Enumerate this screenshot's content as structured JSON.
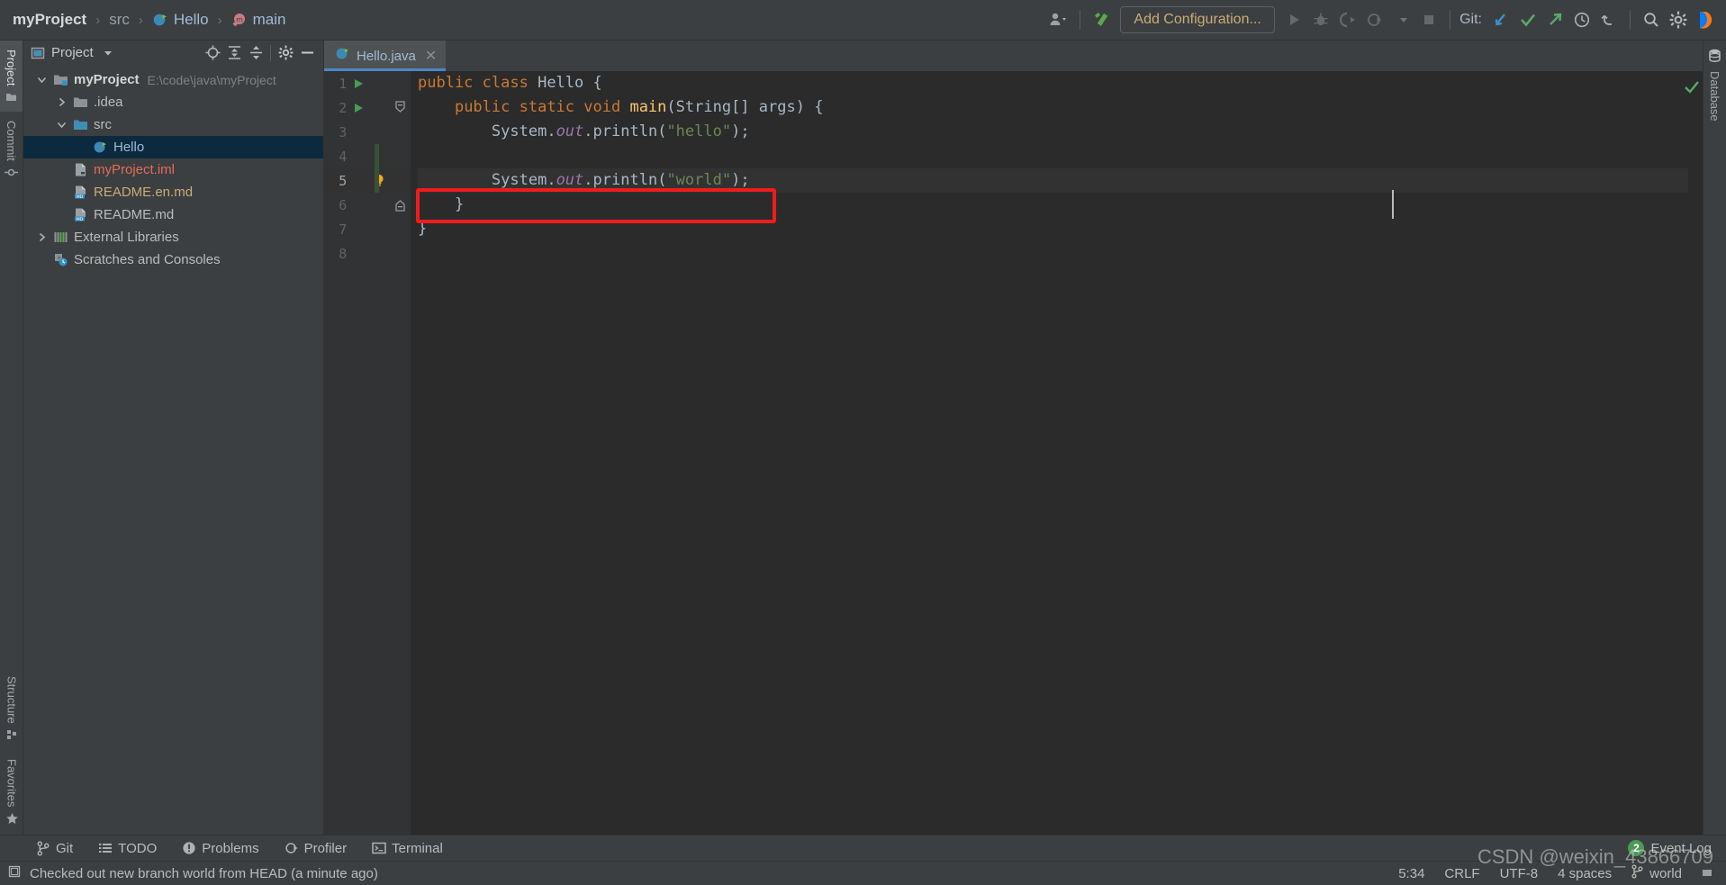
{
  "navbar": {
    "breadcrumbs": [
      {
        "label": "myProject",
        "icon": "",
        "style": "bold"
      },
      {
        "label": "src",
        "icon": "",
        "style": "dim"
      },
      {
        "label": "Hello",
        "icon": "java-class-icon",
        "style": "normal"
      },
      {
        "label": "main",
        "icon": "method-icon",
        "style": "normal"
      }
    ],
    "separator": "›",
    "user_icon": "user-dropdown-icon",
    "build_icon": "build-hammer-icon",
    "add_configuration_label": "Add Configuration...",
    "run_icon": "run-icon",
    "debug_icon": "debug-icon",
    "coverage_icon": "run-coverage-icon",
    "profile_icon": "profile-icon",
    "stop_icon": "stop-icon",
    "git_label": "Git:",
    "git_update_icon": "git-update-project-icon",
    "git_commit_icon": "git-commit-icon",
    "git_push_icon": "git-push-icon",
    "history_icon": "history-icon",
    "undo_icon": "undo-icon",
    "search_icon": "search-everywhere-icon",
    "settings_icon": "settings-gear-icon",
    "ide_icon": "ide-logo-icon"
  },
  "left_rail": {
    "top": [
      {
        "label": "Project",
        "icon": "project-folder-icon",
        "active": true
      },
      {
        "label": "Commit",
        "icon": "commit-icon",
        "active": false
      }
    ],
    "bottom": [
      {
        "label": "Structure",
        "icon": "structure-icon",
        "active": false
      },
      {
        "label": "Favorites",
        "icon": "star-icon",
        "active": false
      }
    ]
  },
  "right_rail": {
    "items": [
      {
        "label": "Database",
        "icon": "database-icon"
      }
    ]
  },
  "project_panel": {
    "title": "Project",
    "title_icon": "project-view-icon",
    "dropdown_icon": "chevron-down-icon",
    "locate_icon": "scroll-from-source-icon",
    "expand_icon": "expand-all-icon",
    "collapse_icon": "collapse-all-icon",
    "settings_icon": "gear-icon",
    "hide_icon": "hide-panel-icon",
    "tree": [
      {
        "label": "myProject",
        "path": "E:\\code\\java\\myProject",
        "icon": "module-folder-icon",
        "twisty": "down",
        "indent": 0,
        "style": "bold",
        "selected": false
      },
      {
        "label": ".idea",
        "path": "",
        "icon": "folder-icon",
        "twisty": "right",
        "indent": 1,
        "style": "normal",
        "selected": false
      },
      {
        "label": "src",
        "path": "",
        "icon": "source-folder-icon",
        "twisty": "down",
        "indent": 1,
        "style": "normal",
        "selected": false
      },
      {
        "label": "Hello",
        "path": "",
        "icon": "java-class-icon",
        "twisty": "none",
        "indent": 2,
        "style": "blue",
        "selected": true
      },
      {
        "label": "myProject.iml",
        "path": "",
        "icon": "iml-file-icon",
        "twisty": "none",
        "indent": 1,
        "style": "red",
        "selected": false
      },
      {
        "label": "README.en.md",
        "path": "",
        "icon": "markdown-file-icon",
        "twisty": "none",
        "indent": 1,
        "style": "orange",
        "selected": false
      },
      {
        "label": "README.md",
        "path": "",
        "icon": "markdown-file-icon",
        "twisty": "none",
        "indent": 1,
        "style": "normal",
        "selected": false
      },
      {
        "label": "External Libraries",
        "path": "",
        "icon": "libraries-icon",
        "twisty": "right",
        "indent": 0,
        "style": "normal",
        "selected": false
      },
      {
        "label": "Scratches and Consoles",
        "path": "",
        "icon": "scratches-icon",
        "twisty": "none",
        "indent": 0,
        "style": "normal",
        "selected": false
      }
    ]
  },
  "editor": {
    "tab": {
      "name": "Hello.java",
      "icon": "java-class-icon",
      "close": "✕"
    },
    "lines": [
      {
        "num": "1",
        "run": true,
        "fold": "none",
        "bulb": false,
        "current": false,
        "changed": false,
        "tokens": [
          {
            "t": "public ",
            "c": "kw"
          },
          {
            "t": "class ",
            "c": "kw"
          },
          {
            "t": "Hello ",
            "c": "cls"
          },
          {
            "t": "{",
            "c": "pl"
          }
        ]
      },
      {
        "num": "2",
        "run": true,
        "fold": "open",
        "bulb": false,
        "current": false,
        "changed": false,
        "tokens": [
          {
            "t": "    ",
            "c": "pl"
          },
          {
            "t": "public ",
            "c": "kw"
          },
          {
            "t": "static ",
            "c": "kw"
          },
          {
            "t": "void ",
            "c": "kw"
          },
          {
            "t": "main",
            "c": "fn"
          },
          {
            "t": "(",
            "c": "pl"
          },
          {
            "t": "String[] ",
            "c": "cls"
          },
          {
            "t": "args",
            "c": "var"
          },
          {
            "t": ") {",
            "c": "pl"
          }
        ]
      },
      {
        "num": "3",
        "run": false,
        "fold": "none",
        "bulb": false,
        "current": false,
        "changed": false,
        "tokens": [
          {
            "t": "        ",
            "c": "pl"
          },
          {
            "t": "System",
            "c": "cls"
          },
          {
            "t": ".",
            "c": "pl"
          },
          {
            "t": "out",
            "c": "fld"
          },
          {
            "t": ".",
            "c": "pl"
          },
          {
            "t": "println",
            "c": "cls"
          },
          {
            "t": "(",
            "c": "pl"
          },
          {
            "t": "\"hello\"",
            "c": "st"
          },
          {
            "t": ");",
            "c": "pl"
          }
        ]
      },
      {
        "num": "4",
        "run": false,
        "fold": "none",
        "bulb": false,
        "current": false,
        "changed": true,
        "tokens": []
      },
      {
        "num": "5",
        "run": false,
        "fold": "none",
        "bulb": true,
        "current": true,
        "changed": true,
        "tokens": [
          {
            "t": "        ",
            "c": "pl"
          },
          {
            "t": "System",
            "c": "cls"
          },
          {
            "t": ".",
            "c": "pl"
          },
          {
            "t": "out",
            "c": "fld"
          },
          {
            "t": ".",
            "c": "pl"
          },
          {
            "t": "println",
            "c": "cls"
          },
          {
            "t": "(",
            "c": "pl"
          },
          {
            "t": "\"world\"",
            "c": "st"
          },
          {
            "t": ");",
            "c": "pl"
          }
        ]
      },
      {
        "num": "6",
        "run": false,
        "fold": "close",
        "bulb": false,
        "current": false,
        "changed": false,
        "tokens": [
          {
            "t": "    }",
            "c": "pl"
          }
        ]
      },
      {
        "num": "7",
        "run": false,
        "fold": "none",
        "bulb": false,
        "current": false,
        "changed": false,
        "tokens": [
          {
            "t": "}",
            "c": "pl"
          }
        ]
      },
      {
        "num": "8",
        "run": false,
        "fold": "none",
        "bulb": false,
        "current": false,
        "changed": false,
        "tokens": []
      }
    ],
    "inspection_status": "ok-check-icon",
    "annotation_box_color": "#f01c1c"
  },
  "bottom_tools": [
    {
      "label": "Git",
      "icon": "git-branch-icon"
    },
    {
      "label": "TODO",
      "icon": "todo-list-icon"
    },
    {
      "label": "Problems",
      "icon": "problems-icon"
    },
    {
      "label": "Profiler",
      "icon": "profiler-icon"
    },
    {
      "label": "Terminal",
      "icon": "terminal-icon"
    }
  ],
  "event_log": {
    "label": "Event Log",
    "count": "2"
  },
  "status_bar": {
    "message_icon": "vcs-message-icon",
    "message": "Checked out new branch world from HEAD (a minute ago)",
    "caret_position": "5:34",
    "line_separator": "CRLF",
    "encoding": "UTF-8",
    "indent": "4 spaces",
    "branch_icon": "git-branch-icon",
    "branch": "world",
    "lock_icon": "readonly-toggle-icon"
  },
  "watermark": "CSDN @weixin_43866709"
}
